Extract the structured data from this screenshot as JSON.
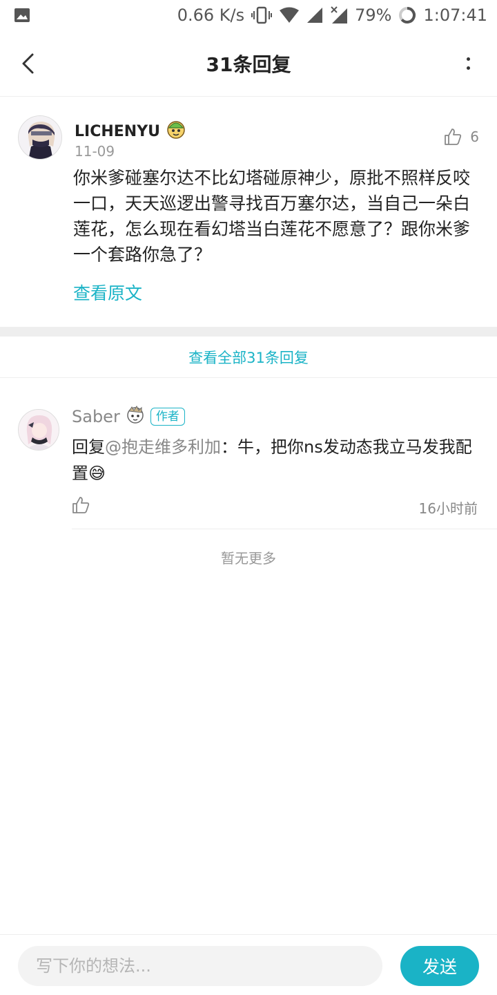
{
  "status_bar": {
    "network_speed": "0.66 K/s",
    "battery": "79%",
    "time": "1:07:41"
  },
  "header": {
    "title": "31条回复"
  },
  "main_comment": {
    "user_name": "LICHENYU",
    "date": "11-09",
    "like_count": "6",
    "text": "你米爹碰塞尔达不比幻塔碰原神少，原批不照样反咬一口，天天巡逻出警寻找百万塞尔达，当自己一朵白莲花，怎么现在看幻塔当白莲花不愿意了？跟你米爹一个套路你急了？",
    "view_original": "查看原文"
  },
  "view_all_replies": "查看全部31条回复",
  "reply": {
    "user_name": "Saber",
    "badge": "作者",
    "prefix": "回复",
    "mention": "@抱走维多利加",
    "text": "：牛，把你ns发动态我立马发我配置😅",
    "time": "16小时前"
  },
  "no_more": "暂无更多",
  "bottom_bar": {
    "input_placeholder": "写下你的想法...",
    "send_label": "发送"
  },
  "colors": {
    "accent": "#1ab3c6",
    "divider": "#eeeeee",
    "muted_text": "#888888"
  }
}
